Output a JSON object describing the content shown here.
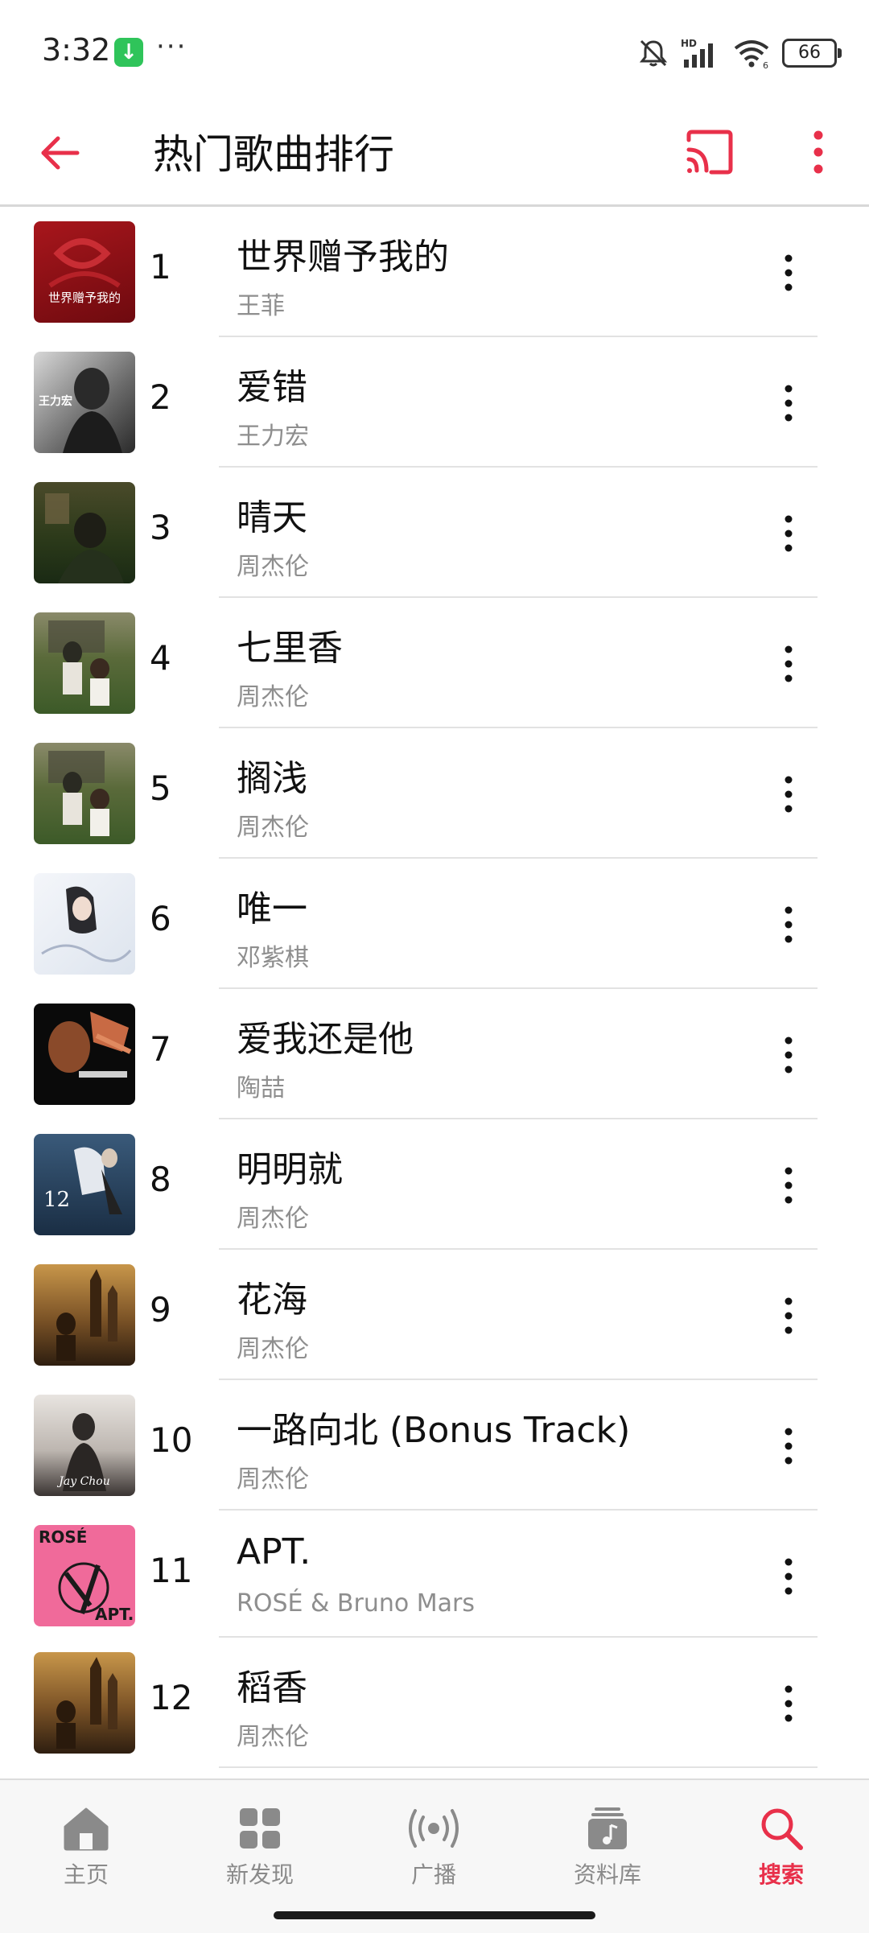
{
  "status_bar": {
    "time": "3:32",
    "more": "···",
    "network": "HD",
    "wifi_sub": "6",
    "battery": "66"
  },
  "header": {
    "title": "热门歌曲排行"
  },
  "songs": [
    {
      "rank": "1",
      "title": "世界赠予我的",
      "artist": "王菲",
      "cover_text": "世界赠予我的"
    },
    {
      "rank": "2",
      "title": "爱错",
      "artist": "王力宏",
      "cover_text": "王力宏"
    },
    {
      "rank": "3",
      "title": "晴天",
      "artist": "周杰伦",
      "cover_text": ""
    },
    {
      "rank": "4",
      "title": "七里香",
      "artist": "周杰伦",
      "cover_text": ""
    },
    {
      "rank": "5",
      "title": "搁浅",
      "artist": "周杰伦",
      "cover_text": ""
    },
    {
      "rank": "6",
      "title": "唯一",
      "artist": "邓紫棋",
      "cover_text": ""
    },
    {
      "rank": "7",
      "title": "爱我还是他",
      "artist": "陶喆",
      "cover_text": ""
    },
    {
      "rank": "8",
      "title": "明明就",
      "artist": "周杰伦",
      "cover_text": "12"
    },
    {
      "rank": "9",
      "title": "花海",
      "artist": "周杰伦",
      "cover_text": ""
    },
    {
      "rank": "10",
      "title": "一路向北 (Bonus Track)",
      "artist": "周杰伦",
      "cover_text": "Jay Chou"
    },
    {
      "rank": "11",
      "title": "APT.",
      "artist": "ROSÉ & Bruno Mars",
      "cover_text": "ROSÉ"
    },
    {
      "rank": "12",
      "title": "稻香",
      "artist": "周杰伦",
      "cover_text": ""
    }
  ],
  "tabs": [
    {
      "label": "主页",
      "icon": "home-icon"
    },
    {
      "label": "新发现",
      "icon": "grid-icon"
    },
    {
      "label": "广播",
      "icon": "radio-icon"
    },
    {
      "label": "资料库",
      "icon": "library-icon"
    },
    {
      "label": "搜索",
      "icon": "search-icon"
    }
  ],
  "colors": {
    "accent": "#e8304a",
    "text": "#111111",
    "secondary": "#8e8e8e"
  }
}
